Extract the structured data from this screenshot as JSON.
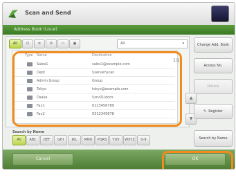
{
  "app": {
    "title": "Scan and Send"
  },
  "header": {
    "text": "Address Book (Local)"
  },
  "filters": [
    {
      "label": "All",
      "active": true
    },
    {
      "label": "⊡"
    },
    {
      "label": "≡"
    },
    {
      "label": "✉"
    },
    {
      "label": "▭"
    },
    {
      "label": "▣"
    }
  ],
  "dest_select": {
    "value": "All"
  },
  "list": {
    "headers": {
      "type": "Type",
      "name": "Name",
      "dest": "Destination"
    },
    "rows": [
      {
        "name": "Sales1",
        "dest": "sales1@example.com"
      },
      {
        "name": "Dept",
        "dest": "\\\\server\\scan"
      },
      {
        "name": "Admin Group",
        "dest": "Group"
      },
      {
        "name": "Tokyo",
        "dest": "tokyo@example.com"
      },
      {
        "name": "Osaka",
        "dest": "\\\\srv01\\docs"
      },
      {
        "name": "Fax1",
        "dest": "0123456789"
      },
      {
        "name": "Fax2",
        "dest": "0312345678"
      }
    ],
    "page": "1/1"
  },
  "right_buttons": {
    "change_book": "Change Add. Book",
    "access_no": "Access No.",
    "details": "Details",
    "register": "Register"
  },
  "search": {
    "label": "Search by Name",
    "keys": [
      "All",
      "ABC",
      "DEF",
      "GHI",
      "JKL",
      "MNO",
      "PQRS",
      "TUV",
      "WXYZ",
      "0-9"
    ],
    "change": "Search by Name"
  },
  "bottom": {
    "cancel": "Cancel",
    "ok": "OK"
  },
  "colors": {
    "highlight": "#f28b1c",
    "accent": "#4d7f34"
  }
}
